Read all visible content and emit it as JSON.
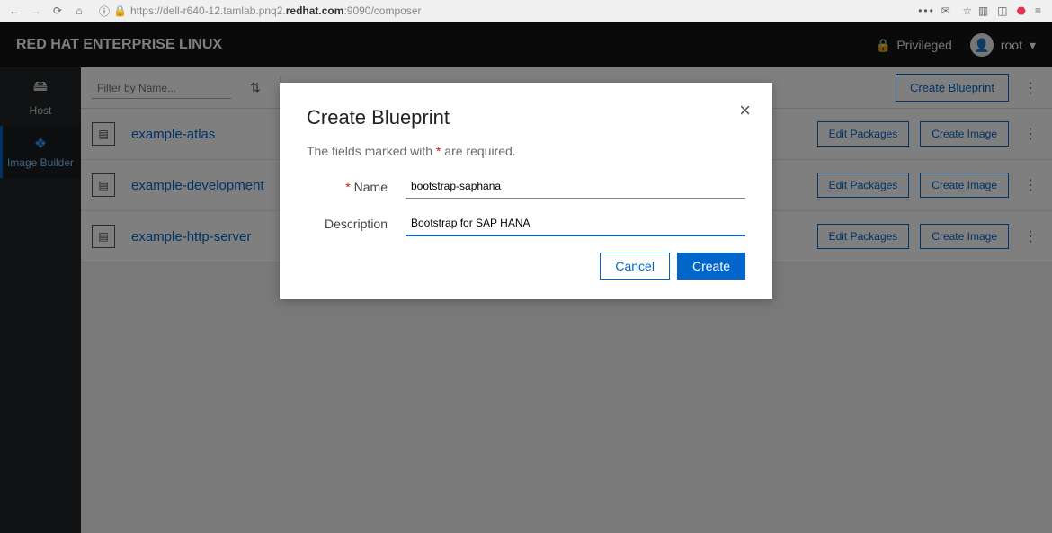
{
  "browser": {
    "url_prefix": "https://dell-r640-12.tamlab.pnq2.",
    "url_bold": "redhat.com",
    "url_suffix": ":9090/composer"
  },
  "header": {
    "title": "RED HAT ENTERPRISE LINUX",
    "privileged": "Privileged",
    "user": "root"
  },
  "sidenav": {
    "items": [
      {
        "label": "Host"
      },
      {
        "label": "Image Builder"
      }
    ]
  },
  "toolbar": {
    "filter_placeholder": "Filter by Name...",
    "create_blueprint": "Create Blueprint"
  },
  "blueprints": [
    {
      "name": "example-atlas"
    },
    {
      "name": "example-development"
    },
    {
      "name": "example-http-server"
    }
  ],
  "row_actions": {
    "edit": "Edit Packages",
    "create_image": "Create Image"
  },
  "modal": {
    "title": "Create Blueprint",
    "helper_a": "The fields marked with ",
    "helper_b": " are required.",
    "star": "*",
    "name_label": "Name",
    "name_value": "bootstrap-saphana",
    "desc_label": "Description",
    "desc_value": "Bootstrap for SAP HANA",
    "cancel": "Cancel",
    "create": "Create"
  }
}
